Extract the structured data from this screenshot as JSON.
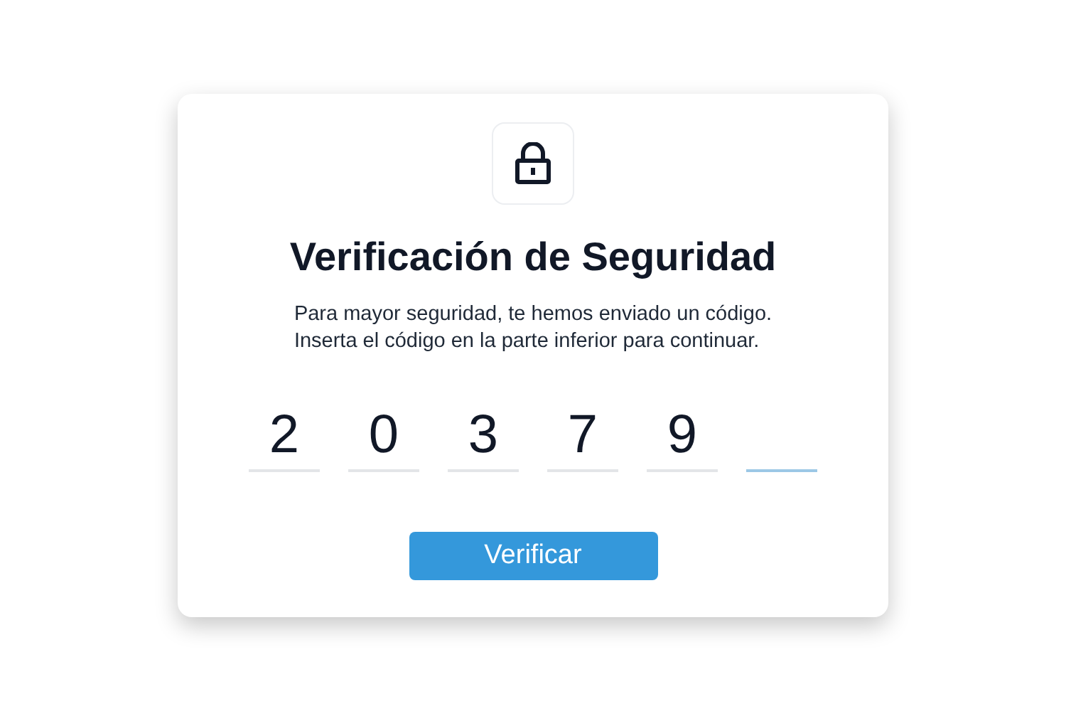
{
  "title": "Verificación de Seguridad",
  "description": [
    "Para mayor seguridad, te hemos enviado un código.",
    "Inserta el código en la parte inferior para continuar."
  ],
  "code_fields": [
    {
      "value": "2",
      "focused": false
    },
    {
      "value": "0",
      "focused": false
    },
    {
      "value": "3",
      "focused": false
    },
    {
      "value": "7",
      "focused": false
    },
    {
      "value": "9",
      "focused": false
    },
    {
      "focused": true
    }
  ],
  "button": "Verificar"
}
